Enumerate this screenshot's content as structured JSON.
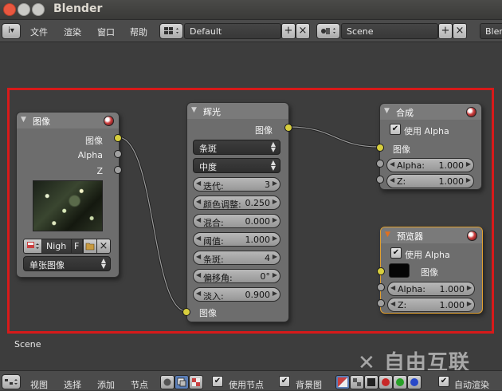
{
  "window": {
    "title": "Blender"
  },
  "topbar": {
    "menus": [
      "文件",
      "渲染",
      "窗口",
      "帮助"
    ],
    "screen_layout": "Default",
    "scene": "Scene",
    "engine_partial": "Blen"
  },
  "nodes": {
    "image": {
      "title": "图像",
      "outputs": [
        "图像",
        "Alpha",
        "Z"
      ],
      "image_name": "Nigh",
      "fake_user": "F",
      "source": "单张图像"
    },
    "glare": {
      "title": "辉光",
      "output": "图像",
      "type": "条斑",
      "quality": "中度",
      "fields": [
        {
          "label": "迭代:",
          "value": "3"
        },
        {
          "label": "颜色调整:",
          "value": "0.250"
        },
        {
          "label": "混合:",
          "value": "0.000"
        },
        {
          "label": "阈值:",
          "value": "1.000"
        },
        {
          "label": "条斑:",
          "value": "4"
        },
        {
          "label": "偏移角:",
          "value": "0°"
        },
        {
          "label": "淡入:",
          "value": "0.900"
        }
      ],
      "input": "图像"
    },
    "composite": {
      "title": "合成",
      "use_alpha": "使用 Alpha",
      "input": "图像",
      "fields": [
        {
          "label": "Alpha:",
          "value": "1.000"
        },
        {
          "label": "Z:",
          "value": "1.000"
        }
      ]
    },
    "viewer": {
      "title": "预览器",
      "use_alpha": "使用 Alpha",
      "input": "图像",
      "fields": [
        {
          "label": "Alpha:",
          "value": "1.000"
        },
        {
          "label": "Z:",
          "value": "1.000"
        }
      ]
    }
  },
  "canvas": {
    "scene_label": "Scene"
  },
  "bottombar": {
    "menus": [
      "视图",
      "选择",
      "添加",
      "节点"
    ],
    "use_nodes": "使用节点",
    "backdrop": "背景图",
    "auto_render": "自动渲染"
  },
  "watermark": "自由互联",
  "colors": {
    "highlight_frame": "#d81a1a",
    "socket_color": "#d8cf3e",
    "socket_value": "#a0a0a0",
    "viewer_border": "#e0a030"
  }
}
